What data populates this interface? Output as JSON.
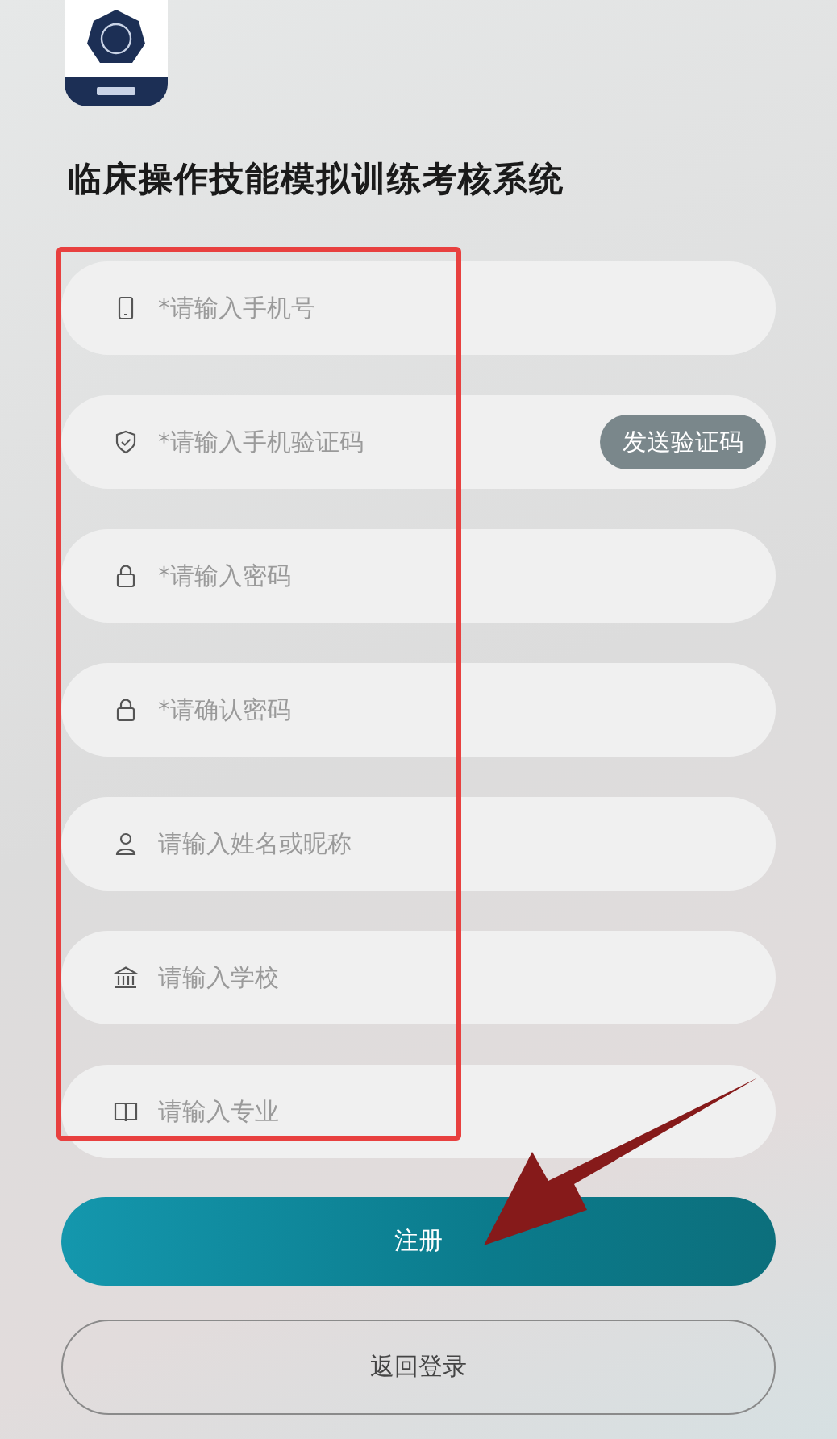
{
  "title": "临床操作技能模拟训练考核系统",
  "fields": [
    {
      "placeholder": "*请输入手机号"
    },
    {
      "placeholder": "*请输入手机验证码",
      "action": "发送验证码"
    },
    {
      "placeholder": "*请输入密码"
    },
    {
      "placeholder": "*请确认密码"
    },
    {
      "placeholder": "请输入姓名或昵称"
    },
    {
      "placeholder": "请输入学校"
    },
    {
      "placeholder": "请输入专业"
    }
  ],
  "primary_button": "注册",
  "secondary_button": "返回登录"
}
